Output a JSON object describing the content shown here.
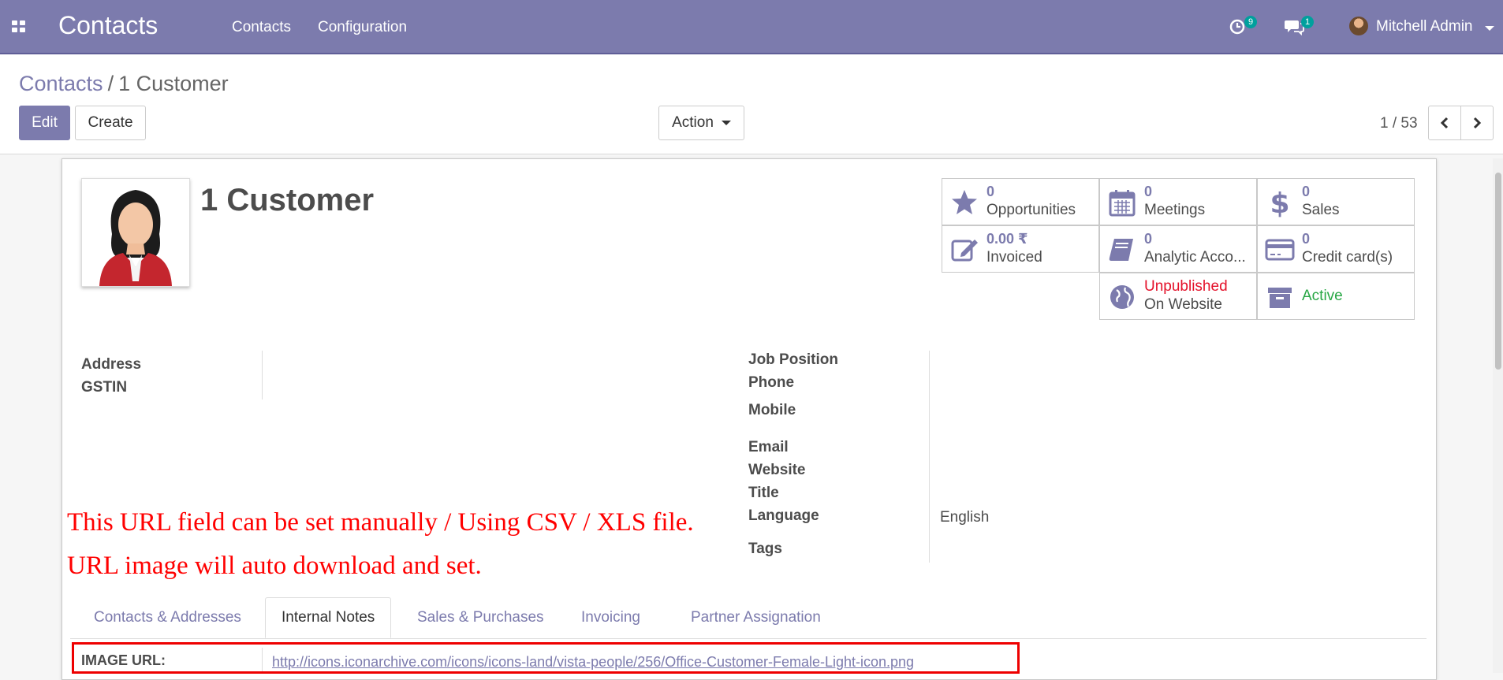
{
  "navbar": {
    "brand": "Contacts",
    "menu": [
      "Contacts",
      "Configuration"
    ],
    "activity_count": "9",
    "message_count": "1",
    "user_name": "Mitchell Admin"
  },
  "control": {
    "breadcrumb_root": "Contacts",
    "breadcrumb_sep": "/",
    "breadcrumb_current": "1 Customer",
    "edit_label": "Edit",
    "create_label": "Create",
    "action_label": "Action",
    "pager": "1 / 53"
  },
  "record": {
    "name": "1 Customer"
  },
  "stats": {
    "opportunities": {
      "value": "0",
      "label": "Opportunities"
    },
    "meetings": {
      "value": "0",
      "label": "Meetings"
    },
    "sales": {
      "value": "0",
      "label": "Sales"
    },
    "invoiced": {
      "value": "0.00 ₹",
      "label": "Invoiced"
    },
    "analytic": {
      "value": "0",
      "label": "Analytic Acco..."
    },
    "credit": {
      "value": "0",
      "label": "Credit card(s)"
    },
    "website": {
      "status": "Unpublished",
      "label": "On Website"
    },
    "active": {
      "label": "Active"
    }
  },
  "fields": {
    "address": "Address",
    "gstin": "GSTIN",
    "job_position": "Job Position",
    "phone": "Phone",
    "mobile": "Mobile",
    "email": "Email",
    "website": "Website",
    "title": "Title",
    "language": "Language",
    "language_value": "English",
    "tags": "Tags"
  },
  "note": {
    "line1": "This URL field can be set manually / Using CSV / XLS file.",
    "line2": "URL image will auto download and set."
  },
  "tabs": [
    "Contacts & Addresses",
    "Internal Notes",
    "Sales & Purchases",
    "Invoicing",
    "Partner Assignation"
  ],
  "image_url": {
    "label": "IMAGE URL:",
    "value": "http://icons.iconarchive.com/icons/icons-land/vista-people/256/Office-Customer-Female-Light-icon.png"
  },
  "colors": {
    "primary": "#7c7bad",
    "badge": "#00a09d",
    "danger": "#e4112a",
    "success": "#28a745",
    "note": "#ff0000"
  }
}
